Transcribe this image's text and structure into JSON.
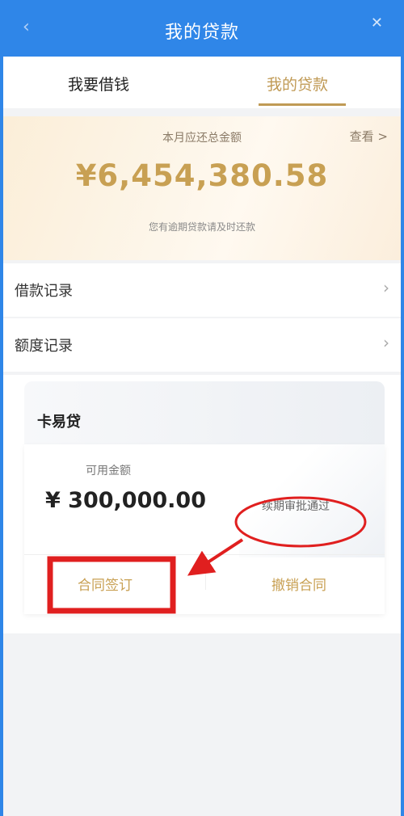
{
  "header": {
    "title": "我的贷款"
  },
  "tabs": [
    {
      "label": "我要借钱"
    },
    {
      "label": "我的贷款"
    }
  ],
  "summary": {
    "label": "本月应还总金额",
    "view_label": "查看 >",
    "amount": "¥6,454,380.58",
    "note": "您有逾期贷款请及时还款"
  },
  "menu": [
    {
      "label": "借款记录"
    },
    {
      "label": "额度记录"
    }
  ],
  "card": {
    "name": "卡易贷",
    "available_label": "可用金额",
    "available_amount": "¥ 300,000.00",
    "status": "续期审批通过",
    "sign_button": "合同签订",
    "cancel_button": "撤销合同"
  },
  "colors": {
    "header_blue": "#2f86e8",
    "gold": "#c8a053",
    "annotation_red": "#e01f1f"
  }
}
